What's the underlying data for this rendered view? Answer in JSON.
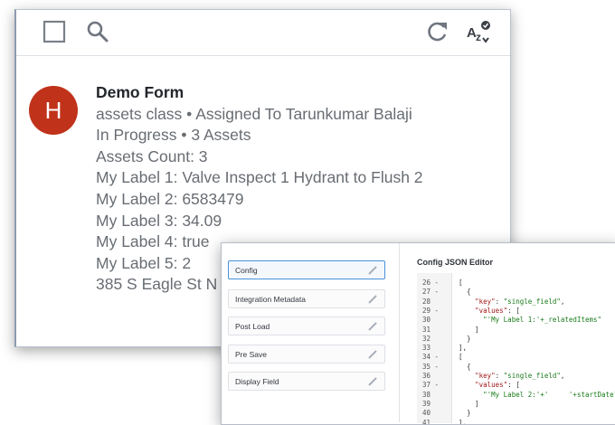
{
  "toolbar": {
    "icons": [
      "checkbox-icon",
      "search-icon",
      "refresh-icon",
      "sort-az-icon"
    ]
  },
  "record": {
    "avatar_letter": "H",
    "avatar_color": "#c0321a",
    "title": "Demo Form",
    "lines": [
      "assets class • Assigned To Tarunkumar Balaji",
      "In Progress • 3 Assets",
      "Assets Count: 3",
      "My Label 1: Valve Inspect 1 Hydrant to Flush 2",
      "My Label 2: 6583479",
      "My Label 3: 34.09",
      "My Label 4: true",
      "My Label 5: 2",
      "385 S Eagle St N"
    ]
  },
  "config_panel": {
    "items": [
      "Config",
      "Integration Metadata",
      "Post Load",
      "Pre Save",
      "Display Field"
    ],
    "selected": "Config",
    "accent_color": "#4a90d9"
  },
  "editor": {
    "title": "Config JSON Editor",
    "lines": [
      {
        "n": "26",
        "fold": "-",
        "text": "["
      },
      {
        "n": "27",
        "fold": "-",
        "text": "  {"
      },
      {
        "n": "28",
        "fold": "",
        "text": "    \"key\": \"single_field\","
      },
      {
        "n": "29",
        "fold": "-",
        "text": "    \"values\": ["
      },
      {
        "n": "30",
        "fold": "",
        "text": "      \"'My Label 1:'+_relatedItems\""
      },
      {
        "n": "31",
        "fold": "",
        "text": "    ]"
      },
      {
        "n": "32",
        "fold": "",
        "text": "  }"
      },
      {
        "n": "33",
        "fold": "",
        "text": "],"
      },
      {
        "n": "34",
        "fold": "-",
        "text": "["
      },
      {
        "n": "35",
        "fold": "-",
        "text": "  {"
      },
      {
        "n": "36",
        "fold": "",
        "text": "    \"key\": \"single_field\","
      },
      {
        "n": "37",
        "fold": "-",
        "text": "    \"values\": ["
      },
      {
        "n": "38",
        "fold": "",
        "text": "      \"'My Label 2:'+'     '+startDate\""
      },
      {
        "n": "39",
        "fold": "",
        "text": "    ]"
      },
      {
        "n": "40",
        "fold": "",
        "text": "  }"
      },
      {
        "n": "41",
        "fold": "",
        "text": "],"
      }
    ]
  }
}
